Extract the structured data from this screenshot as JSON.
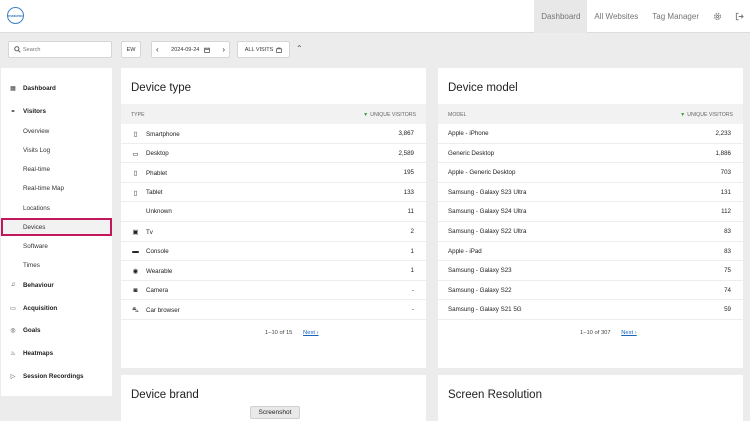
{
  "header": {
    "logo_text": "matomo",
    "nav": [
      {
        "label": "Dashboard",
        "active": true
      },
      {
        "label": "All Websites"
      },
      {
        "label": "Tag Manager"
      }
    ]
  },
  "toolbar": {
    "search_placeholder": "Search",
    "period": "EW",
    "date": "2024-09-24",
    "segment": "ALL VISITS"
  },
  "sidebar": {
    "items": [
      {
        "label": "Dashboard",
        "icon": "dashboard-icon",
        "type": "cat"
      },
      {
        "label": "Visitors",
        "icon": "visitors-icon",
        "type": "cat"
      },
      {
        "label": "Overview",
        "type": "sub"
      },
      {
        "label": "Visits Log",
        "type": "sub"
      },
      {
        "label": "Real-time",
        "type": "sub"
      },
      {
        "label": "Real-time Map",
        "type": "sub"
      },
      {
        "label": "Locations",
        "type": "sub"
      },
      {
        "label": "Devices",
        "type": "sub",
        "selected": true
      },
      {
        "label": "Software",
        "type": "sub"
      },
      {
        "label": "Times",
        "type": "sub"
      },
      {
        "label": "Behaviour",
        "icon": "bell-icon",
        "type": "cat"
      },
      {
        "label": "Acquisition",
        "icon": "acquisition-icon",
        "type": "cat"
      },
      {
        "label": "Goals",
        "icon": "goals-icon",
        "type": "cat"
      },
      {
        "label": "Heatmaps",
        "icon": "heatmaps-icon",
        "type": "cat"
      },
      {
        "label": "Session Recordings",
        "icon": "play-icon",
        "type": "cat"
      }
    ]
  },
  "device_type": {
    "title": "Device type",
    "col_left": "TYPE",
    "col_right": "UNIQUE VISITORS",
    "rows": [
      {
        "label": "Smartphone",
        "value": "3,867",
        "icon": "smartphone-icon"
      },
      {
        "label": "Desktop",
        "value": "2,589",
        "icon": "desktop-icon"
      },
      {
        "label": "Phablet",
        "value": "195",
        "icon": "phablet-icon"
      },
      {
        "label": "Tablet",
        "value": "133",
        "icon": "tablet-icon"
      },
      {
        "label": "Unknown",
        "value": "11",
        "icon": ""
      },
      {
        "label": "Tv",
        "value": "2",
        "icon": "tv-icon"
      },
      {
        "label": "Console",
        "value": "1",
        "icon": "console-icon"
      },
      {
        "label": "Wearable",
        "value": "1",
        "icon": "wearable-icon"
      },
      {
        "label": "Camera",
        "value": "-",
        "icon": "camera-icon"
      },
      {
        "label": "Car browser",
        "value": "-",
        "icon": "car-icon"
      }
    ],
    "pager": "1–10 of 15",
    "next": "Next ›"
  },
  "device_model": {
    "title": "Device model",
    "col_left": "MODEL",
    "col_right": "UNIQUE VISITORS",
    "rows": [
      {
        "label": "Apple - iPhone",
        "value": "2,233"
      },
      {
        "label": "Generic Desktop",
        "value": "1,886"
      },
      {
        "label": "Apple - Generic Desktop",
        "value": "703"
      },
      {
        "label": "Samsung - Galaxy S23 Ultra",
        "value": "131"
      },
      {
        "label": "Samsung - Galaxy S24 Ultra",
        "value": "112"
      },
      {
        "label": "Samsung - Galaxy S22 Ultra",
        "value": "83"
      },
      {
        "label": "Apple - iPad",
        "value": "83"
      },
      {
        "label": "Samsung - Galaxy S23",
        "value": "75"
      },
      {
        "label": "Samsung - Galaxy S22",
        "value": "74"
      },
      {
        "label": "Samsung - Galaxy S21 5G",
        "value": "59"
      }
    ],
    "pager": "1–10 of 307",
    "next": "Next ›"
  },
  "device_brand": {
    "title": "Device brand"
  },
  "screen_resolution": {
    "title": "Screen Resolution"
  },
  "tooltip": "Screenshot"
}
